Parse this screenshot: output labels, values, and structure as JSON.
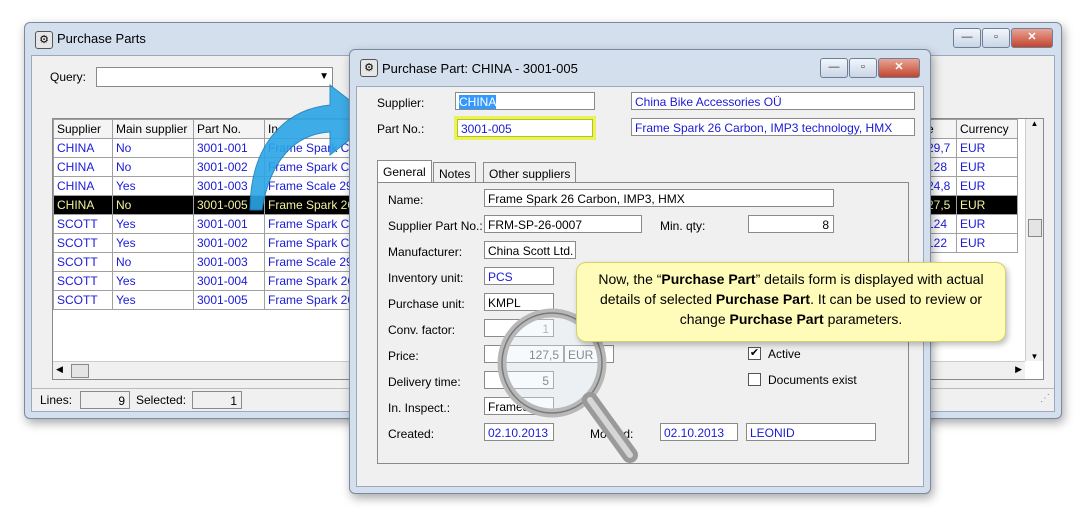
{
  "main_window": {
    "title": "Purchase Parts",
    "query_label": "Query:",
    "columns": [
      "Supplier",
      "Main supplier",
      "Part No.",
      "In",
      "e",
      "Currency"
    ],
    "rows": [
      {
        "supplier": "CHINA",
        "main": "No",
        "part": "3001-001",
        "name": "Frame Spark Car",
        "price": "29,7",
        "cur": "EUR"
      },
      {
        "supplier": "CHINA",
        "main": "No",
        "part": "3001-002",
        "name": "Frame Spark Car",
        "price": "128",
        "cur": "EUR"
      },
      {
        "supplier": "CHINA",
        "main": "Yes",
        "part": "3001-003",
        "name": "Frame Scale 29",
        "price": "24,8",
        "cur": "EUR"
      },
      {
        "supplier": "CHINA",
        "main": "No",
        "part": "3001-005",
        "name": "Frame Spark 26",
        "price": "27,5",
        "cur": "EUR"
      },
      {
        "supplier": "SCOTT",
        "main": "Yes",
        "part": "3001-001",
        "name": "Frame Spark Car",
        "price": "124",
        "cur": "EUR"
      },
      {
        "supplier": "SCOTT",
        "main": "Yes",
        "part": "3001-002",
        "name": "Frame Spark Car",
        "price": "122",
        "cur": "EUR"
      },
      {
        "supplier": "SCOTT",
        "main": "No",
        "part": "3001-003",
        "name": "Frame Scale 29",
        "price": "",
        "cur": ""
      },
      {
        "supplier": "SCOTT",
        "main": "Yes",
        "part": "3001-004",
        "name": "Frame Spark 26",
        "price": "",
        "cur": ""
      },
      {
        "supplier": "SCOTT",
        "main": "Yes",
        "part": "3001-005",
        "name": "Frame Spark 26",
        "price": "",
        "cur": ""
      }
    ],
    "lines_label": "Lines:",
    "lines_value": "9",
    "selected_label": "Selected:",
    "selected_value": "1"
  },
  "detail_window": {
    "title": "Purchase Part: CHINA - 3001-005",
    "supplier_label": "Supplier:",
    "supplier_code": "CHINA",
    "supplier_name": "China Bike Accessories OÜ",
    "partno_label": "Part No.:",
    "part_no": "3001-005",
    "part_desc": "Frame Spark 26 Carbon, IMP3 technology, HMX",
    "tabs": [
      "General",
      "Notes",
      "Other suppliers"
    ],
    "name_label": "Name:",
    "name_value": "Frame Spark 26 Carbon, IMP3, HMX",
    "supplier_part_label": "Supplier Part No.:",
    "supplier_part_value": "FRM-SP-26-0007",
    "min_qty_label": "Min. qty:",
    "min_qty_value": "8",
    "manufacturer_label": "Manufacturer:",
    "manufacturer_value": "China Scott Ltd.",
    "inventory_unit_label": "Inventory unit:",
    "inventory_unit_value": "PCS",
    "purchase_unit_label": "Purchase unit:",
    "purchase_unit_value": "KMPL",
    "conv_factor_label": "Conv. factor:",
    "conv_factor_value": "1",
    "price_label": "Price:",
    "price_value": "127,5",
    "price_currency": "EUR",
    "delivery_label": "Delivery time:",
    "delivery_value": "5",
    "inspect_label": "In. Inspect.:",
    "inspect_value": "Frames",
    "created_label": "Created:",
    "created_value": "02.10.2013",
    "modified_label": "Mo     d:",
    "modified_value": "02.10.2013",
    "modified_by": "LEONID",
    "active_label": "Active",
    "active_checked": true,
    "documents_label": "Documents exist",
    "documents_checked": false
  },
  "callout": {
    "part1": "Now, the “",
    "bold1": "Purchase Part",
    "part2": "” details form is displayed with actual details of selected ",
    "bold2": "Purchase Part",
    "part3": ".  It can be used to review or change ",
    "bold3": "Purchase Part",
    "part4": " parameters."
  },
  "colors": {
    "link_blue": "#1a1ad6",
    "selection": "#000000",
    "highlight": "#e8f25a",
    "callout_bg": "#fffbb8",
    "arrow": "#2aa5e6"
  }
}
